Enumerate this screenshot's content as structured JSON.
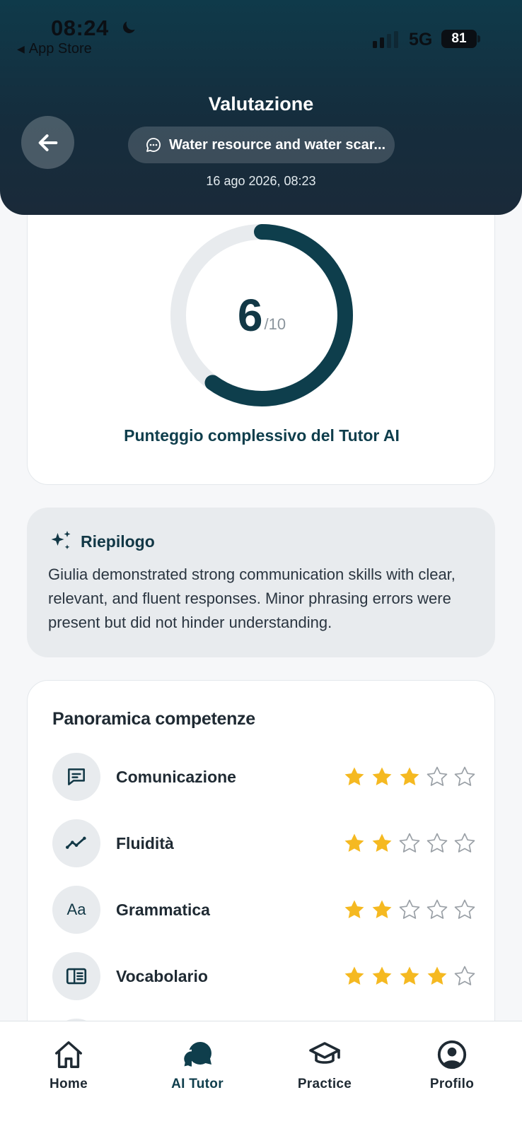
{
  "status_bar": {
    "time": "08:24",
    "back_app": "App Store",
    "network": "5G",
    "battery": "81"
  },
  "header": {
    "title": "Valutazione",
    "topic": "Water resource and water scar...",
    "date": "16 ago 2026, 08:23"
  },
  "score": {
    "value": "6",
    "max": "/10",
    "fraction": 0.6,
    "caption": "Punteggio complessivo del Tutor AI"
  },
  "summary": {
    "title": "Riepilogo",
    "text": "Giulia demonstrated strong communication skills with clear, relevant, and fluent responses. Minor phrasing errors were present but did not hinder understanding."
  },
  "skills": {
    "title": "Panoramica competenze",
    "items": [
      {
        "label": "Comunicazione",
        "icon": "chat-lines-icon",
        "rating": 3
      },
      {
        "label": "Fluidità",
        "icon": "trend-line-icon",
        "rating": 2
      },
      {
        "label": "Grammatica",
        "icon": "text-aa-icon",
        "icon_text": "Aa",
        "rating": 2
      },
      {
        "label": "Vocabolario",
        "icon": "book-icon",
        "rating": 4
      }
    ],
    "max_rating": 5
  },
  "nav": {
    "items": [
      {
        "label": "Home",
        "icon": "home-icon"
      },
      {
        "label": "AI Tutor",
        "icon": "chat-bubbles-icon",
        "active": true
      },
      {
        "label": "Practice",
        "icon": "graduation-cap-icon"
      },
      {
        "label": "Profilo",
        "icon": "user-circle-icon"
      }
    ]
  },
  "colors": {
    "header_dark": "#152d3d",
    "accent": "#0f3e4c",
    "star_filled": "#f5b921",
    "star_empty": "#9aa0a6"
  }
}
